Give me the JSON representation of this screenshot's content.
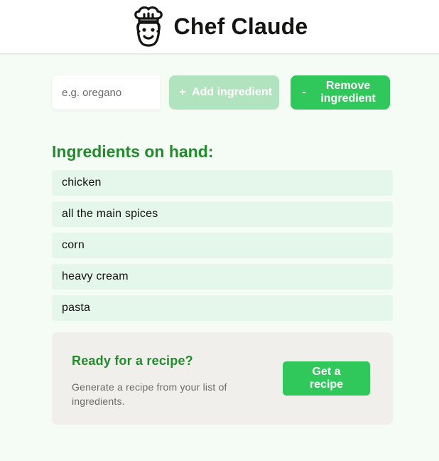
{
  "header": {
    "title": "Chef Claude",
    "logo_icon": "chef-face-icon"
  },
  "form": {
    "input_placeholder": "e.g. oregano",
    "input_value": "",
    "add_button": {
      "symbol": "+",
      "label": "Add ingredient",
      "state": "disabled"
    },
    "remove_button": {
      "symbol": "-",
      "label": "Remove ingredient"
    }
  },
  "ingredients": {
    "heading": "Ingredients on hand:",
    "items": [
      "chicken",
      "all the main spices",
      "corn",
      "heavy cream",
      "pasta"
    ]
  },
  "recipe_card": {
    "heading": "Ready for a recipe?",
    "text": "Generate a recipe from your list of ingredients.",
    "button_label": "Get a recipe"
  },
  "colors": {
    "accent": "#30c85b",
    "accent_disabled": "#b1e4be",
    "heading_green": "#228b2b",
    "page_bg": "#f4fcf5",
    "list_item_bg": "#e5f7ea",
    "card_bg": "#f0efeb"
  }
}
